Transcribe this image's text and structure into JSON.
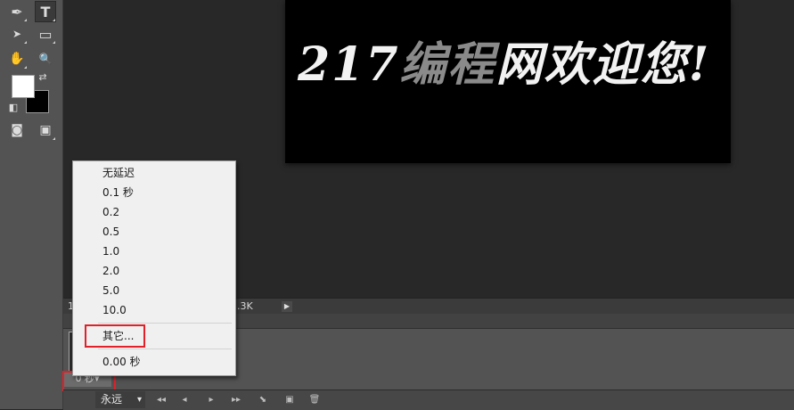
{
  "tools": [
    {
      "name": "pen-icon",
      "glyph": "✒"
    },
    {
      "name": "type-icon",
      "glyph": "T"
    },
    {
      "name": "path-select-icon",
      "glyph": "➤"
    },
    {
      "name": "rectangle-icon",
      "glyph": "▭"
    },
    {
      "name": "hand-icon",
      "glyph": "✋"
    },
    {
      "name": "zoom-icon",
      "glyph": "🔍"
    },
    {
      "name": "swap-colors-icon",
      "glyph": "⇄"
    },
    {
      "name": "default-colors-icon",
      "glyph": "◧"
    },
    {
      "name": "quick-mask-icon",
      "glyph": "◙"
    },
    {
      "name": "screen-mode-icon",
      "glyph": "▣"
    }
  ],
  "document": {
    "text_white_1": "217",
    "text_gray": "编程",
    "text_white_2": "网欢迎您!"
  },
  "status": {
    "left_text": "1",
    "size_text": "2.3K",
    "arrow": "▶"
  },
  "animation": {
    "frame_delay": "0 秒▾",
    "loop": "永远",
    "loop_arrow": "▾"
  },
  "controls": [
    "◂◂",
    "◂",
    "▸",
    "▸▸",
    "⬊",
    "▣",
    "🗑"
  ],
  "delay_menu": {
    "items": [
      "无延迟",
      "0.1 秒",
      "0.2",
      "0.5",
      "1.0",
      "2.0",
      "5.0",
      "10.0"
    ],
    "other": "其它...",
    "current": "0.00 秒"
  },
  "colors": {
    "highlight": "#e1202a",
    "foreground": "#ffffff",
    "background": "#000000"
  }
}
